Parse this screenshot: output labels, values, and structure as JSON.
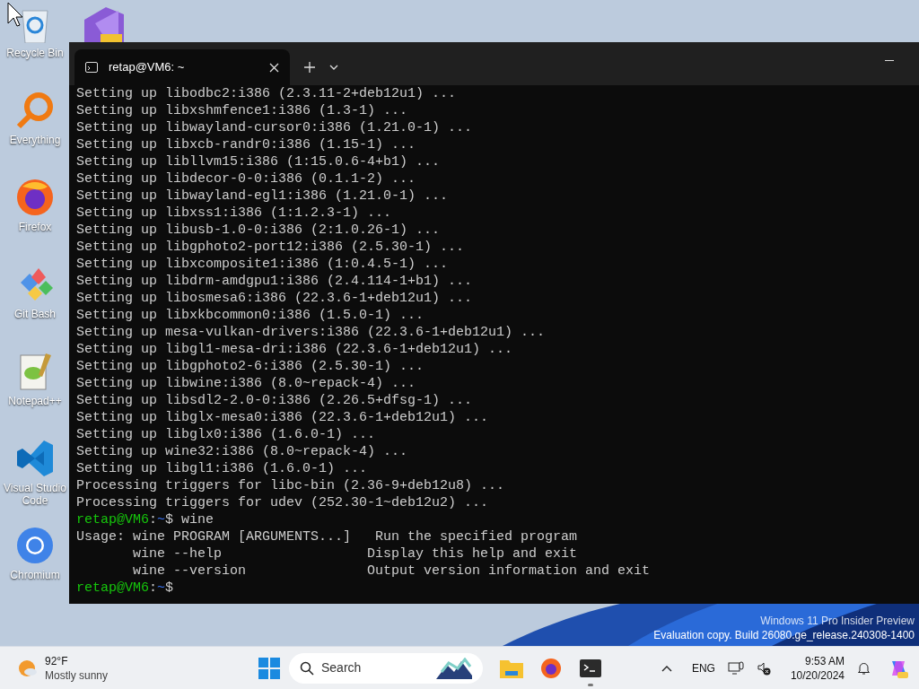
{
  "desktop_icons": [
    {
      "kind": "recycle",
      "label": "Recycle Bin"
    },
    {
      "kind": "everything",
      "label": "Everything"
    },
    {
      "kind": "firefox",
      "label": "Firefox"
    },
    {
      "kind": "gitbash",
      "label": "Git Bash"
    },
    {
      "kind": "notepad",
      "label": "Notepad++"
    },
    {
      "kind": "vscode",
      "label": "Visual Studio Code"
    },
    {
      "kind": "chromium",
      "label": "Chromium"
    }
  ],
  "terminal": {
    "tab_title": "retap@VM6: ~",
    "lines": [
      {
        "kind": "text",
        "text": "Setting up libodbc2:i386 (2.3.11-2+deb12u1) ..."
      },
      {
        "kind": "text",
        "text": "Setting up libxshmfence1:i386 (1.3-1) ..."
      },
      {
        "kind": "text",
        "text": "Setting up libwayland-cursor0:i386 (1.21.0-1) ..."
      },
      {
        "kind": "text",
        "text": "Setting up libxcb-randr0:i386 (1.15-1) ..."
      },
      {
        "kind": "text",
        "text": "Setting up libllvm15:i386 (1:15.0.6-4+b1) ..."
      },
      {
        "kind": "text",
        "text": "Setting up libdecor-0-0:i386 (0.1.1-2) ..."
      },
      {
        "kind": "text",
        "text": "Setting up libwayland-egl1:i386 (1.21.0-1) ..."
      },
      {
        "kind": "text",
        "text": "Setting up libxss1:i386 (1:1.2.3-1) ..."
      },
      {
        "kind": "text",
        "text": "Setting up libusb-1.0-0:i386 (2:1.0.26-1) ..."
      },
      {
        "kind": "text",
        "text": "Setting up libgphoto2-port12:i386 (2.5.30-1) ..."
      },
      {
        "kind": "text",
        "text": "Setting up libxcomposite1:i386 (1:0.4.5-1) ..."
      },
      {
        "kind": "text",
        "text": "Setting up libdrm-amdgpu1:i386 (2.4.114-1+b1) ..."
      },
      {
        "kind": "text",
        "text": "Setting up libosmesa6:i386 (22.3.6-1+deb12u1) ..."
      },
      {
        "kind": "text",
        "text": "Setting up libxkbcommon0:i386 (1.5.0-1) ..."
      },
      {
        "kind": "text",
        "text": "Setting up mesa-vulkan-drivers:i386 (22.3.6-1+deb12u1) ..."
      },
      {
        "kind": "text",
        "text": "Setting up libgl1-mesa-dri:i386 (22.3.6-1+deb12u1) ..."
      },
      {
        "kind": "text",
        "text": "Setting up libgphoto2-6:i386 (2.5.30-1) ..."
      },
      {
        "kind": "text",
        "text": "Setting up libwine:i386 (8.0~repack-4) ..."
      },
      {
        "kind": "text",
        "text": "Setting up libsdl2-2.0-0:i386 (2.26.5+dfsg-1) ..."
      },
      {
        "kind": "text",
        "text": "Setting up libglx-mesa0:i386 (22.3.6-1+deb12u1) ..."
      },
      {
        "kind": "text",
        "text": "Setting up libglx0:i386 (1.6.0-1) ..."
      },
      {
        "kind": "text",
        "text": "Setting up wine32:i386 (8.0~repack-4) ..."
      },
      {
        "kind": "text",
        "text": "Setting up libgl1:i386 (1.6.0-1) ..."
      },
      {
        "kind": "text",
        "text": "Processing triggers for libc-bin (2.36-9+deb12u8) ..."
      },
      {
        "kind": "text",
        "text": "Processing triggers for udev (252.30-1~deb12u2) ..."
      },
      {
        "kind": "prompt",
        "user": "retap@VM6",
        "separator": ":",
        "path": "~",
        "symbol": "$",
        "command": "wine"
      },
      {
        "kind": "text",
        "text": "Usage: wine PROGRAM [ARGUMENTS...]   Run the specified program"
      },
      {
        "kind": "text",
        "text": "       wine --help                  Display this help and exit"
      },
      {
        "kind": "text",
        "text": "       wine --version               Output version information and exit"
      },
      {
        "kind": "prompt",
        "user": "retap@VM6",
        "separator": ":",
        "path": "~",
        "symbol": "$"
      }
    ]
  },
  "watermark": [
    "Windows 11 Pro Insider Preview",
    "Evaluation copy. Build 26080.ge_release.240308-1400"
  ],
  "taskbar": {
    "weather": {
      "temperature": "92°F",
      "condition": "Mostly sunny"
    },
    "search": {
      "placeholder": "Search"
    },
    "apps": [
      {
        "kind": "explorer",
        "running": false
      },
      {
        "kind": "firefox",
        "running": false
      },
      {
        "kind": "terminal",
        "running": true
      }
    ],
    "tray": {
      "language": "ENG",
      "time": "9:53 AM",
      "date": "10/20/2024"
    }
  }
}
